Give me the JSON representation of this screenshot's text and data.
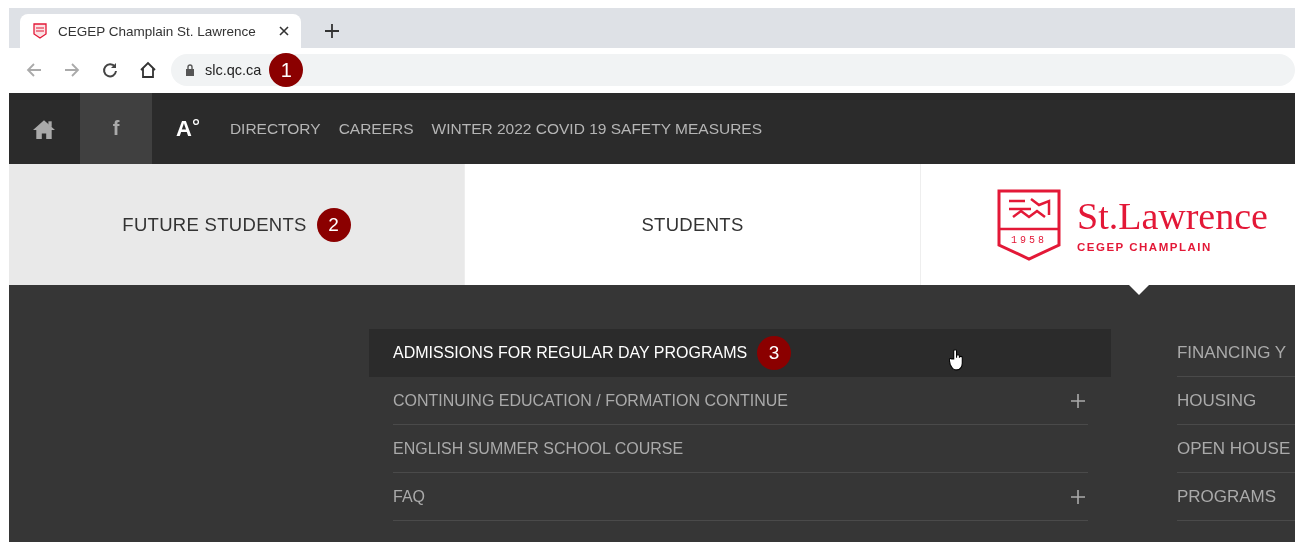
{
  "browser": {
    "tab_title": "CEGEP Champlain St. Lawrence",
    "url": "slc.qc.ca",
    "url_badge": "1"
  },
  "top_nav": {
    "facebook": "f",
    "accessibility": "A",
    "links": [
      "DIRECTORY",
      "CAREERS",
      "WINTER 2022 COVID 19 SAFETY MEASURES"
    ]
  },
  "audience_tabs": [
    {
      "label": "FUTURE STUDENTS",
      "selected": true,
      "badge": "2"
    },
    {
      "label": "STUDENTS",
      "selected": false
    }
  ],
  "logo": {
    "name": "St.Lawrence",
    "subtitle": "CEGEP CHAMPLAIN",
    "year": "1958"
  },
  "menu": {
    "left": [
      {
        "label": "ADMISSIONS FOR REGULAR DAY PROGRAMS",
        "selected": true,
        "expandable": false,
        "badge": "3"
      },
      {
        "label": "CONTINUING EDUCATION / FORMATION CONTINUE",
        "selected": false,
        "expandable": true
      },
      {
        "label": "ENGLISH SUMMER SCHOOL COURSE",
        "selected": false,
        "expandable": false
      },
      {
        "label": "FAQ",
        "selected": false,
        "expandable": true
      }
    ],
    "right": [
      "FINANCING Y",
      "HOUSING",
      "OPEN HOUSE",
      "PROGRAMS"
    ]
  }
}
